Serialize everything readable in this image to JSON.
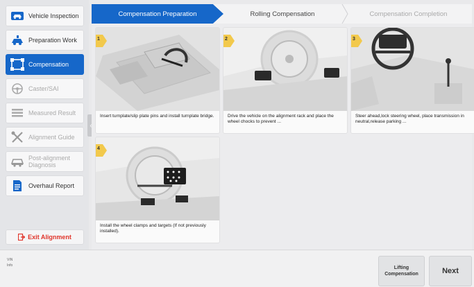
{
  "sidebar": {
    "items": [
      {
        "label": "Vehicle Inspection",
        "icon": "car-inspection-icon",
        "state": "normal"
      },
      {
        "label": "Preparation Work",
        "icon": "wrench-car-icon",
        "state": "normal"
      },
      {
        "label": "Compensation",
        "icon": "compensation-icon",
        "state": "active"
      },
      {
        "label": "Caster/SAI",
        "icon": "steering-wheel-icon",
        "state": "disabled"
      },
      {
        "label": "Measured Result",
        "icon": "list-icon",
        "state": "disabled"
      },
      {
        "label": "Alignment Guide",
        "icon": "tools-icon",
        "state": "disabled"
      },
      {
        "label": "Post-alignment Diagnosis",
        "icon": "car-diagnosis-icon",
        "state": "disabled"
      },
      {
        "label": "Overhaul Report",
        "icon": "report-icon",
        "state": "normal"
      }
    ],
    "exit_label": "Exit Alignment"
  },
  "steps": [
    {
      "label": "Compensation Preparation",
      "state": "active"
    },
    {
      "label": "Rolling Compensation",
      "state": "normal"
    },
    {
      "label": "Compensation Completion",
      "state": "disabled"
    }
  ],
  "cards": [
    {
      "num": "1",
      "text": "Insert turnplate/slip plate pins and install turnplate bridge."
    },
    {
      "num": "2",
      "text": "Drive the vehicle on the alignment rack and place the wheel chocks to prevent ..."
    },
    {
      "num": "3",
      "text": "Steer ahead,lock steering wheel, place transmission in neutral,release parking ..."
    },
    {
      "num": "4",
      "text": "Install the wheel clamps and targets (If not previously installed)."
    }
  ],
  "bottom": {
    "vin_label": "VIN",
    "info_label": "Info",
    "lifting_label": "Lifting Compensation",
    "next_label": "Next"
  },
  "colors": {
    "accent": "#1667c9",
    "exit": "#e0352b",
    "badge": "#f2c94c"
  }
}
